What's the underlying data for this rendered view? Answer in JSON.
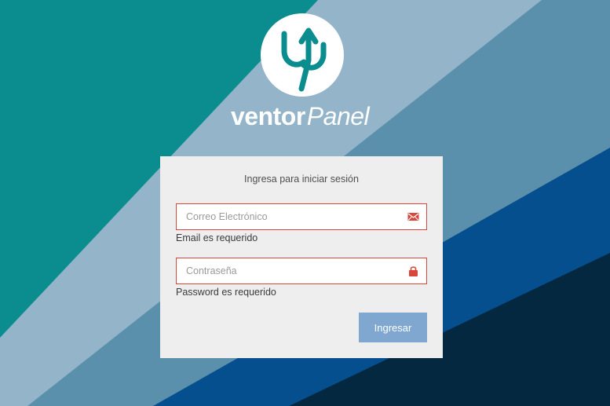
{
  "brand": {
    "name_bold": "ventor",
    "name_light": "Panel"
  },
  "login": {
    "heading": "Ingresa para iniciar sesión",
    "email": {
      "placeholder": "Correo Electrónico",
      "value": "",
      "error": "Email es requerido",
      "icon": "envelope-icon"
    },
    "password": {
      "placeholder": "Contraseña",
      "value": "",
      "error": "Password es requerido",
      "icon": "lock-icon"
    },
    "submit_label": "Ingresar"
  },
  "colors": {
    "teal": "#0b8c8f",
    "steel_light": "#93b4c9",
    "steel_mid": "#5a90ab",
    "blue": "#064f8f",
    "navy": "#042840",
    "error_red": "#d9463a",
    "button": "#7fa7cf",
    "card": "#eeeeee"
  }
}
